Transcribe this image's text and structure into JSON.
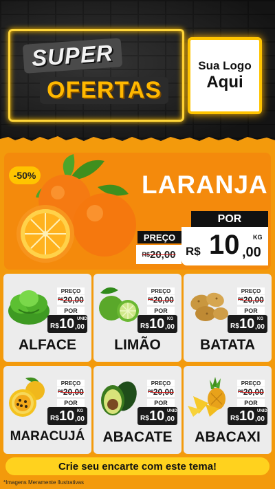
{
  "header": {
    "title_line1": "SUPER",
    "title_line2": "OFERTAS",
    "logo_line1": "Sua Logo",
    "logo_line2": "Aqui"
  },
  "featured": {
    "name": "LARANJA",
    "discount": "-50%",
    "old_label": "PREÇO",
    "old_currency": "R$",
    "old_price": "20,00",
    "new_label": "POR",
    "new_currency": "R$",
    "new_price_int": "10",
    "new_price_dec": ",00",
    "unit": "KG",
    "image": "orange-icon"
  },
  "products": [
    {
      "name": "ALFACE",
      "old_label": "PREÇO",
      "old_currency": "R$",
      "old_price": "20,00",
      "new_label": "POR",
      "currency": "R$",
      "price_int": "10",
      "price_dec": ",00",
      "unit": "UNID",
      "image": "lettuce-icon"
    },
    {
      "name": "LIMÃO",
      "old_label": "PREÇO",
      "old_currency": "R$",
      "old_price": "20,00",
      "new_label": "POR",
      "currency": "R$",
      "price_int": "10",
      "price_dec": ",00",
      "unit": "KG",
      "image": "lime-icon"
    },
    {
      "name": "BATATA",
      "old_label": "PREÇO",
      "old_currency": "R$",
      "old_price": "20,00",
      "new_label": "POR",
      "currency": "R$",
      "price_int": "10",
      "price_dec": ",00",
      "unit": "KG",
      "image": "potato-icon"
    },
    {
      "name": "MARACUJÁ",
      "old_label": "PREÇO",
      "old_currency": "R$",
      "old_price": "20,00",
      "new_label": "POR",
      "currency": "R$",
      "price_int": "10",
      "price_dec": ",00",
      "unit": "KG",
      "image": "passion-fruit-icon"
    },
    {
      "name": "ABACATE",
      "old_label": "PREÇO",
      "old_currency": "R$",
      "old_price": "20,00",
      "new_label": "POR",
      "currency": "R$",
      "price_int": "10",
      "price_dec": ",00",
      "unit": "UNID",
      "image": "avocado-icon"
    },
    {
      "name": "ABACAXI",
      "old_label": "PREÇO",
      "old_currency": "R$",
      "old_price": "20,00",
      "new_label": "POR",
      "currency": "R$",
      "price_int": "10",
      "price_dec": ",00",
      "unit": "UNID",
      "image": "pineapple-icon"
    }
  ],
  "cta": "Crie seu encarte com este tema!",
  "disclaimer": "*Imagens Meramente Ilustrativas",
  "colors": {
    "accent_orange": "#f48a0c",
    "accent_yellow": "#ffd21e",
    "dark": "#111111"
  }
}
